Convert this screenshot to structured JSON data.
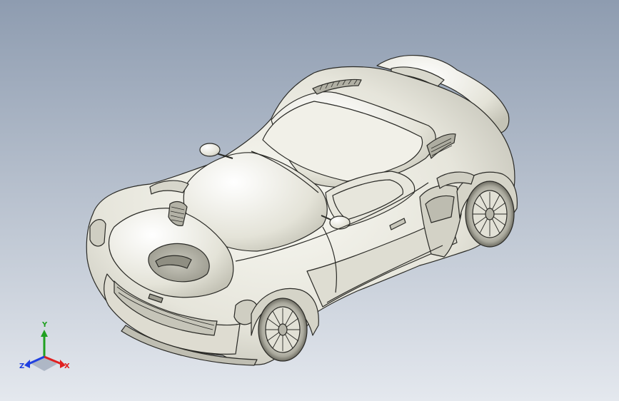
{
  "viewport": {
    "background_top": "#8e9cb0",
    "background_bottom": "#e4e8ee",
    "model_fill": "#eae9e0",
    "model_edge": "#2a2a26",
    "subject": "car-body-3d-model"
  },
  "triad": {
    "x_label": "X",
    "y_label": "Y",
    "z_label": "Z",
    "x_color": "#e02020",
    "y_color": "#20a020",
    "z_color": "#2040e0"
  }
}
